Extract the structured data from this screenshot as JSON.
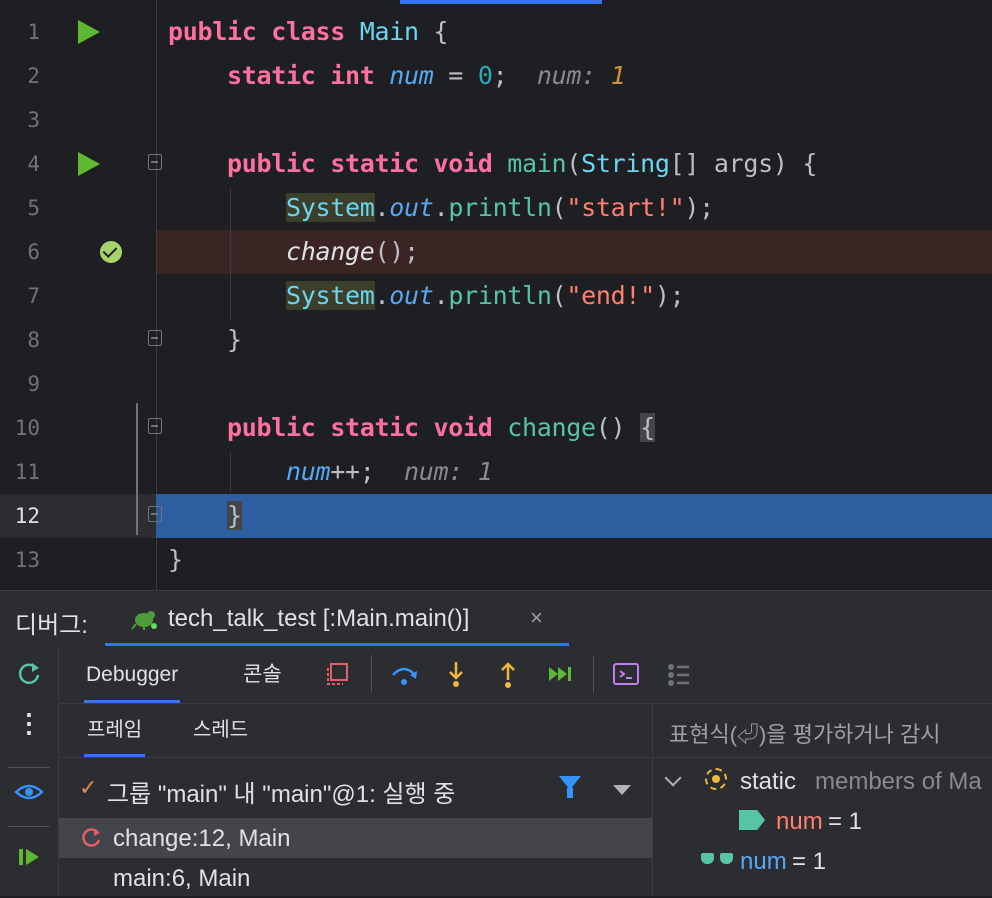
{
  "editor": {
    "lines": [
      {
        "n": "1",
        "tokens": [
          {
            "t": "public class ",
            "c": "kw"
          },
          {
            "t": "Main",
            "c": "cls"
          },
          {
            "t": " {",
            "c": ""
          }
        ]
      },
      {
        "n": "2",
        "tokens": [
          {
            "t": "    static int ",
            "c": "kw"
          },
          {
            "t": "num",
            "c": "fld"
          },
          {
            "t": " = ",
            "c": ""
          },
          {
            "t": "0",
            "c": "num"
          },
          {
            "t": ";  ",
            "c": ""
          },
          {
            "t": "num: ",
            "c": "hint"
          },
          {
            "t": "1",
            "c": "hint-v"
          }
        ]
      },
      {
        "n": "3",
        "tokens": []
      },
      {
        "n": "4",
        "tokens": [
          {
            "t": "    public static void ",
            "c": "kw"
          },
          {
            "t": "main",
            "c": "fn"
          },
          {
            "t": "(",
            "c": ""
          },
          {
            "t": "String",
            "c": "cls"
          },
          {
            "t": "[] args) {",
            "c": ""
          }
        ]
      },
      {
        "n": "5",
        "tokens": [
          {
            "t": "        ",
            "c": ""
          },
          {
            "t": "System",
            "c": "cls sysbg"
          },
          {
            "t": ".",
            "c": ""
          },
          {
            "t": "out",
            "c": "fld"
          },
          {
            "t": ".",
            "c": ""
          },
          {
            "t": "println",
            "c": "fn"
          },
          {
            "t": "(",
            "c": ""
          },
          {
            "t": "\"start!\"",
            "c": "str"
          },
          {
            "t": ");",
            "c": ""
          }
        ]
      },
      {
        "n": "6",
        "tokens": [
          {
            "t": "        ",
            "c": ""
          },
          {
            "t": "change",
            "c": "static-fn"
          },
          {
            "t": "();",
            "c": ""
          }
        ]
      },
      {
        "n": "7",
        "tokens": [
          {
            "t": "        ",
            "c": ""
          },
          {
            "t": "System",
            "c": "cls sysbg"
          },
          {
            "t": ".",
            "c": ""
          },
          {
            "t": "out",
            "c": "fld"
          },
          {
            "t": ".",
            "c": ""
          },
          {
            "t": "println",
            "c": "fn"
          },
          {
            "t": "(",
            "c": ""
          },
          {
            "t": "\"end!\"",
            "c": "str"
          },
          {
            "t": ");",
            "c": ""
          }
        ]
      },
      {
        "n": "8",
        "tokens": [
          {
            "t": "    }",
            "c": ""
          }
        ]
      },
      {
        "n": "9",
        "tokens": []
      },
      {
        "n": "10",
        "tokens": [
          {
            "t": "    public static void ",
            "c": "kw"
          },
          {
            "t": "change",
            "c": "fn"
          },
          {
            "t": "() ",
            "c": ""
          },
          {
            "t": "{",
            "c": "brace-hl"
          }
        ]
      },
      {
        "n": "11",
        "tokens": [
          {
            "t": "        ",
            "c": ""
          },
          {
            "t": "num",
            "c": "fld"
          },
          {
            "t": "++;  ",
            "c": ""
          },
          {
            "t": "num: 1",
            "c": "hint"
          }
        ]
      },
      {
        "n": "12",
        "tokens": [
          {
            "t": "    ",
            "c": ""
          },
          {
            "t": "}",
            "c": "brace-hl"
          }
        ]
      },
      {
        "n": "13",
        "tokens": [
          {
            "t": "}",
            "c": ""
          }
        ]
      }
    ],
    "current_line_color": "#2d5fa0",
    "breakpoint_line_color": "#3b2424",
    "gutter_run_icons": "run-icon"
  },
  "debug": {
    "title": "디버그:",
    "session_tab": "tech_talk_test [:Main.main()]",
    "close_icon": "×",
    "toolbar": {
      "tab_debugger": "Debugger",
      "tab_console": "콘솔"
    },
    "subtabs": {
      "frames": "프레임",
      "threads": "스레드"
    },
    "thread_label": "그룹 \"main\" 내 \"main\"@1: 실행 중",
    "frames": [
      "change:12, Main",
      "main:6, Main"
    ],
    "vars_placeholder": "표현식(⏎)을 평가하거나 감시",
    "vars": {
      "static_label": "static",
      "static_members": "members of Ma",
      "num_name": "num",
      "num_value": " = 1",
      "watch_name": "num",
      "watch_value": " = 1"
    }
  }
}
